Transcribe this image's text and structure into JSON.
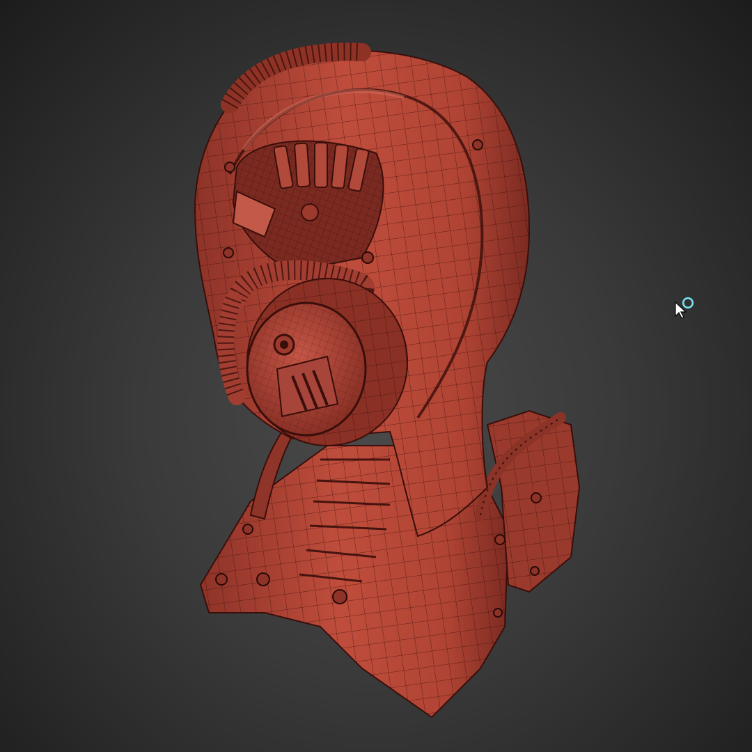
{
  "viewport": {
    "background_top": "#222222",
    "background_bottom": "#4a4a4a"
  },
  "model": {
    "name": "sci-fi-helmet-wireframe",
    "base_color": "#b84a3a",
    "shadow_color": "#7a2a22",
    "highlight_color": "#d06a5a",
    "wire_color": "#3a0e0a"
  },
  "cursor": {
    "icon": "move-cursor-icon",
    "ring_color": "#7fe0ee"
  }
}
